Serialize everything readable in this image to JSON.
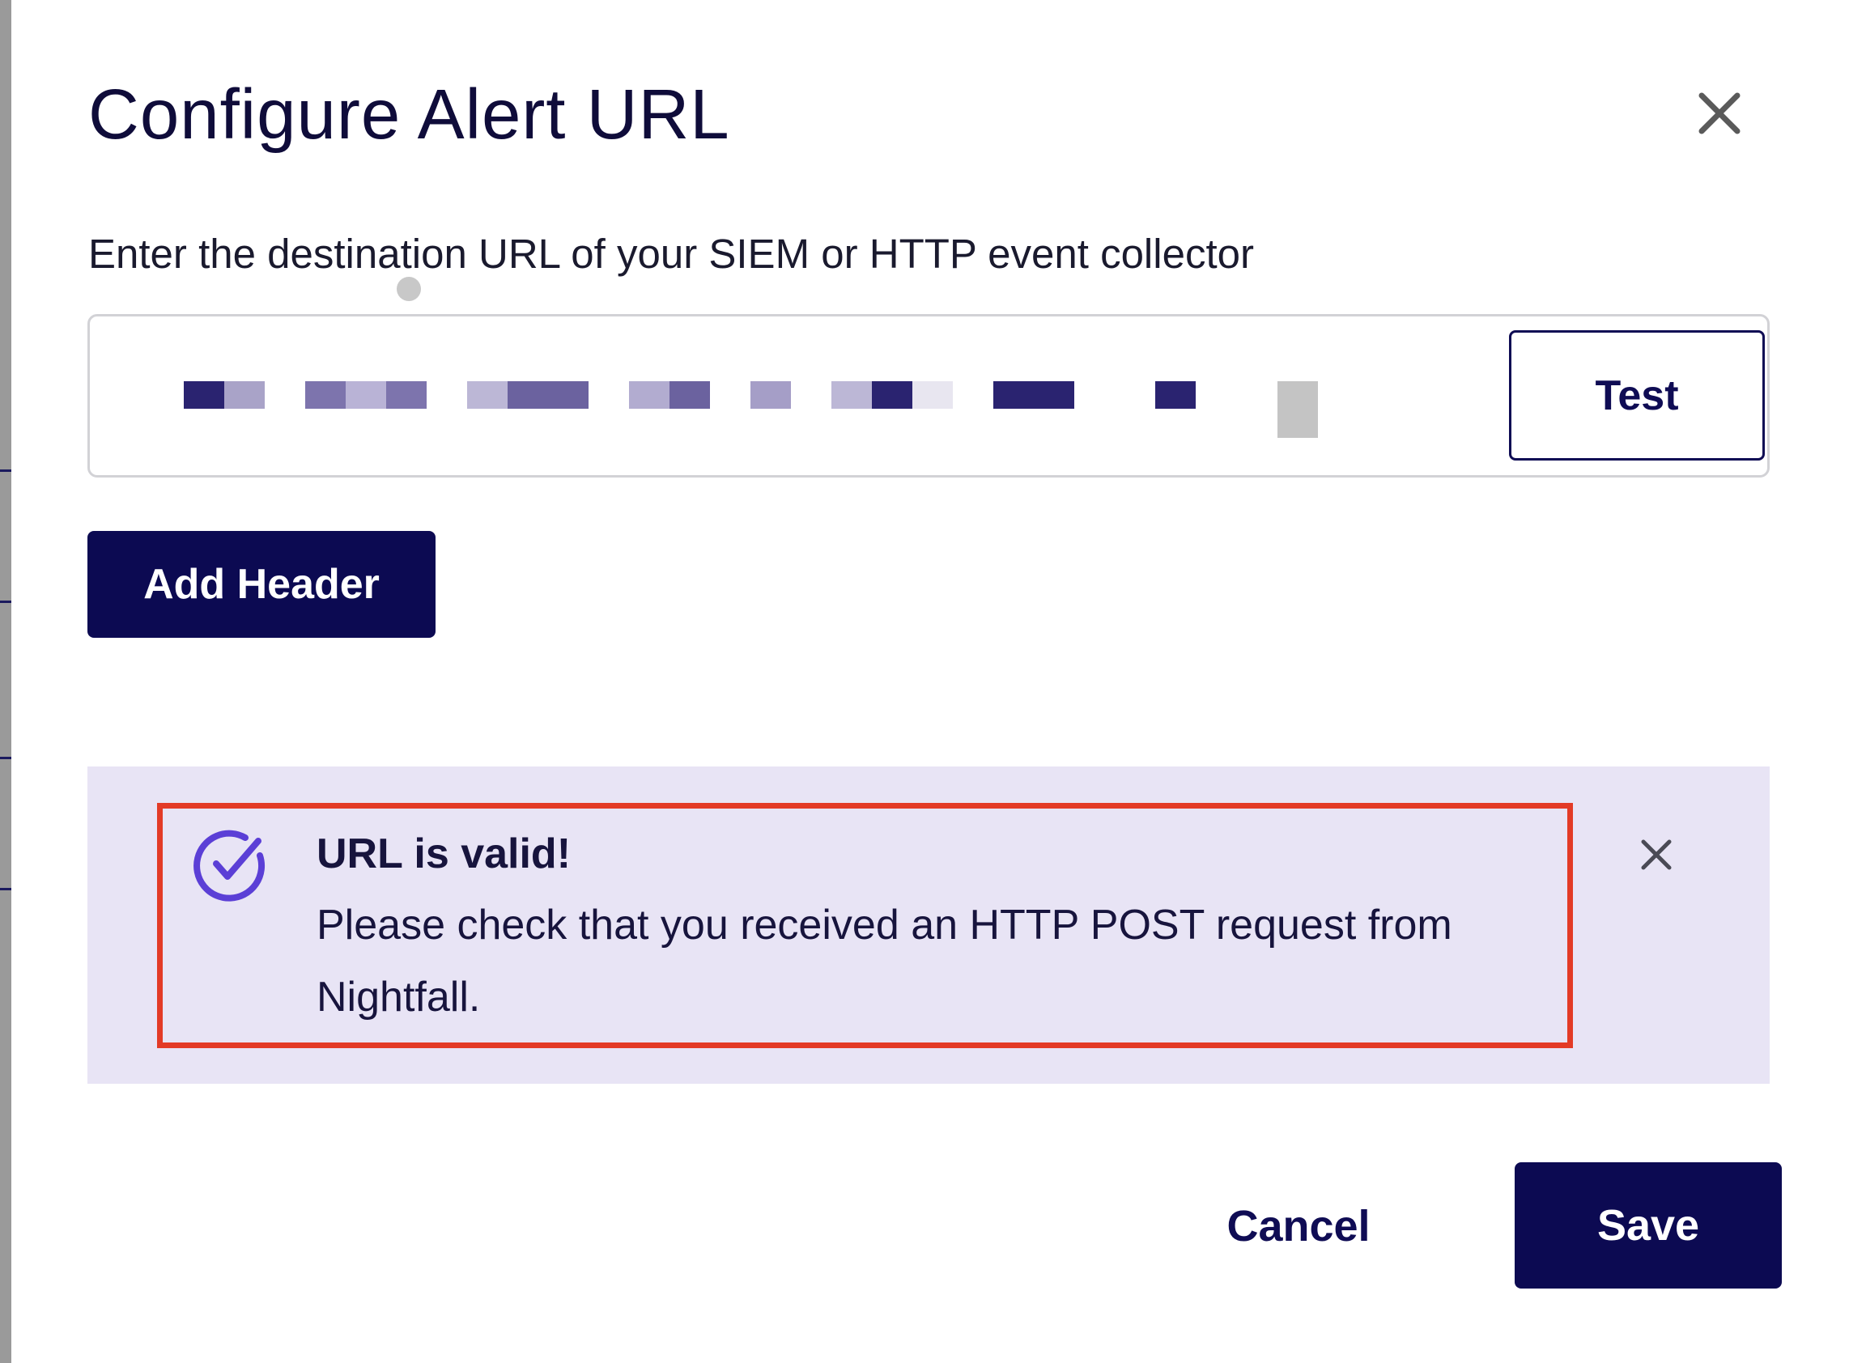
{
  "dialog": {
    "title": "Configure Alert URL",
    "close_icon": "close-icon",
    "instruction": "Enter the destination URL of your SIEM or HTTP event collector"
  },
  "url_field": {
    "value": "",
    "redacted": true,
    "test_label": "Test"
  },
  "actions": {
    "add_header_label": "Add Header",
    "cancel_label": "Cancel",
    "save_label": "Save"
  },
  "alert": {
    "icon": "check-circle-icon",
    "title": "URL is valid!",
    "message": "Please check that you received an HTTP POST request from Nightfall.",
    "close_icon": "close-icon"
  },
  "colors": {
    "primary": "#0c0a52",
    "alert_background": "#e8e4f5",
    "success_icon": "#5b3fd6",
    "highlight_border": "#e33a26"
  }
}
